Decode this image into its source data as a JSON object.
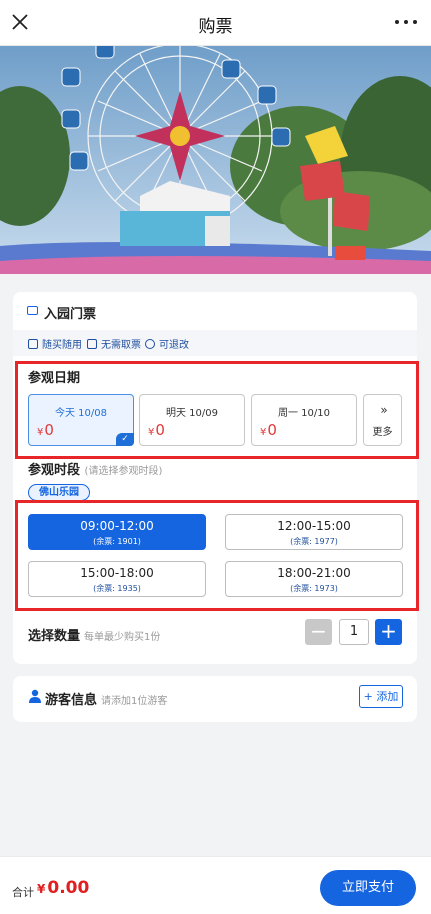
{
  "header": {
    "title": "购票"
  },
  "ticket": {
    "title": "入园门票",
    "features": [
      "随买随用",
      "无需取票",
      "可退改"
    ]
  },
  "visit_date": {
    "label": "参观日期",
    "options": [
      {
        "label": "今天 10/08",
        "currency": "¥",
        "price": "0",
        "selected": true
      },
      {
        "label": "明天 10/09",
        "currency": "¥",
        "price": "0",
        "selected": false
      },
      {
        "label": "周一 10/10",
        "currency": "¥",
        "price": "0",
        "selected": false
      }
    ],
    "more_label": "更多",
    "more_glyph": "»"
  },
  "visit_time": {
    "label": "参观时段",
    "hint": "(请选择参观时段)",
    "park_tag": "佛山乐园",
    "slots": [
      {
        "time": "09:00-12:00",
        "remaining": "(余票: 1901)",
        "selected": true
      },
      {
        "time": "12:00-15:00",
        "remaining": "(余票: 1977)",
        "selected": false
      },
      {
        "time": "15:00-18:00",
        "remaining": "(余票: 1935)",
        "selected": false
      },
      {
        "time": "18:00-21:00",
        "remaining": "(余票: 1973)",
        "selected": false
      }
    ]
  },
  "quantity": {
    "label": "选择数量",
    "hint": "每单最少购买1份",
    "minus": "−",
    "value": "1",
    "plus": "+"
  },
  "visitor": {
    "label": "游客信息",
    "hint": "请添加1位游客",
    "add_label": "+ 添加"
  },
  "footer": {
    "total_label": "合计",
    "currency": "¥",
    "total_value": "0.00",
    "pay_label": "立即支付"
  },
  "colors": {
    "accent": "#1565e0",
    "price": "#e02020",
    "highlight_frame": "#e8262a"
  }
}
